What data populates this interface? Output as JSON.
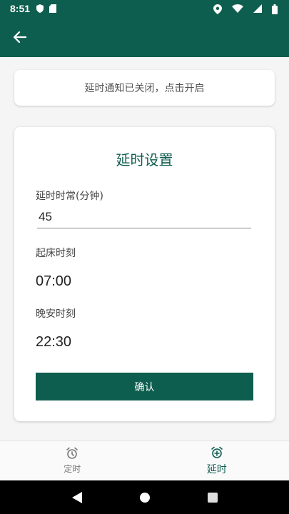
{
  "colors": {
    "primary": "#0e5e4f",
    "background": "#f5f5f5"
  },
  "status_bar": {
    "time": "8:51"
  },
  "app_bar": {
    "back_icon": "arrow-left-icon"
  },
  "notice": {
    "text": "延时通知已关闭，点击开启"
  },
  "settings_card": {
    "title": "延时设置",
    "duration_label": "延时时常(分钟)",
    "duration_value": "45",
    "wake_label": "起床时刻",
    "wake_time": "07:00",
    "night_label": "晚安时刻",
    "night_time": "22:30",
    "confirm_label": "确认"
  },
  "bottom_nav": {
    "items": [
      {
        "label": "定时",
        "icon": "alarm-clock-icon",
        "active": false
      },
      {
        "label": "延时",
        "icon": "alarm-add-icon",
        "active": true
      }
    ]
  }
}
